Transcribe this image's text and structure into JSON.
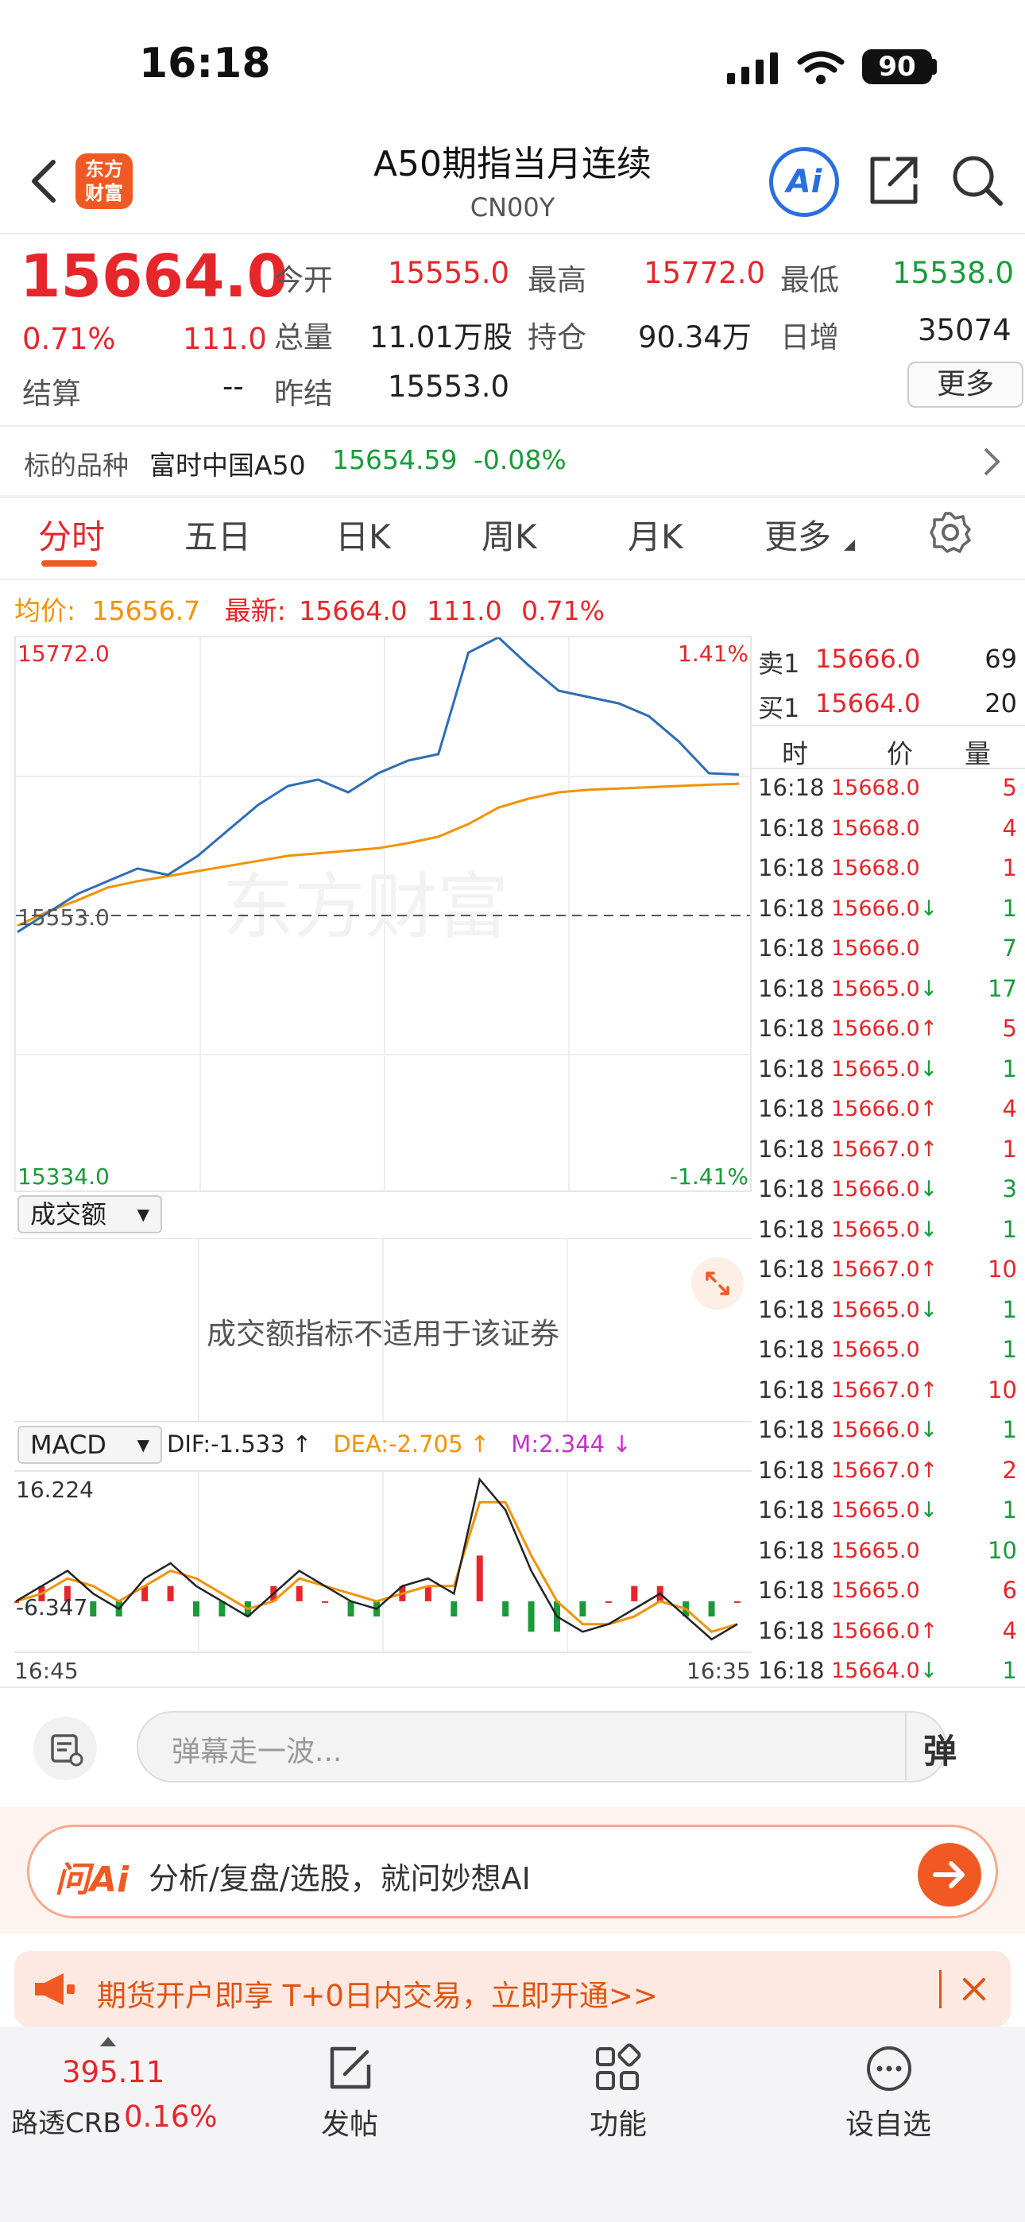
{
  "status_bar": {
    "time": "16:18",
    "battery": "90"
  },
  "nav": {
    "logo_line1": "东方",
    "logo_line2": "财富",
    "title": "A50期指当月连续",
    "code": "CN00Y",
    "ai_label": "Ai"
  },
  "quote": {
    "price": "15664.0",
    "change_pct": "0.71%",
    "change": "111.0",
    "settle_label": "结算",
    "settle": "--",
    "open_label": "今开",
    "open": "15555.0",
    "high_label": "最高",
    "high": "15772.0",
    "low_label": "最低",
    "low": "15538.0",
    "volume_label": "总量",
    "volume": "11.01万股",
    "oi_label": "持仓",
    "oi": "90.34万",
    "daily_inc_label": "日增",
    "daily_inc": "35074",
    "prev_settle_label": "昨结",
    "prev_settle": "15553.0",
    "more_label": "更多"
  },
  "underlying": {
    "label": "标的品种",
    "name": "富时中国A50",
    "price": "15654.59",
    "change": "-0.08%"
  },
  "tabs": [
    "分时",
    "五日",
    "日K",
    "周K",
    "月K",
    "更多"
  ],
  "chart_header": {
    "avg_label": "均价:",
    "avg_value": "15656.7",
    "latest_label": "最新:",
    "latest_value": "15664.0",
    "latest_change": "111.0",
    "latest_pct": "0.71%"
  },
  "chart_data": {
    "type": "line",
    "price_axis": {
      "top": "15772.0",
      "mid": "15553.0",
      "bottom": "15334.0",
      "top_pct": "1.41%",
      "bottom_pct": "-1.41%"
    },
    "ylim": [
      15334.0,
      15772.0
    ],
    "series": [
      {
        "name": "最新",
        "values": [
          15540,
          15555,
          15570,
          15580,
          15590,
          15585,
          15600,
          15620,
          15640,
          15655,
          15660,
          15650,
          15665,
          15675,
          15680,
          15760,
          15772,
          15750,
          15730,
          15725,
          15720,
          15710,
          15690,
          15665,
          15664
        ]
      },
      {
        "name": "均价",
        "values": [
          15545,
          15556,
          15565,
          15575,
          15580,
          15584,
          15588,
          15592,
          15596,
          15600,
          15602,
          15604,
          15606,
          15610,
          15615,
          15625,
          15638,
          15645,
          15650,
          15652,
          15653,
          15654,
          15655,
          15656,
          15656.7
        ]
      }
    ]
  },
  "volume_panel": {
    "selector": "成交额",
    "notice": "成交额指标不适用于该证券"
  },
  "macd_panel": {
    "selector": "MACD",
    "dif": "DIF:-1.533 ↑",
    "dea": "DEA:-2.705 ↑",
    "m": "M:2.344 ↓",
    "top": "16.224",
    "bottom": "-6.347",
    "time_start": "16:45",
    "time_end": "16:35",
    "dif_values": [
      0,
      2,
      4,
      1,
      -1,
      3,
      5,
      2,
      0,
      -2,
      1,
      4,
      2,
      0,
      -1,
      2,
      3,
      1,
      16,
      12,
      4,
      -2,
      -4,
      -3,
      -1,
      1,
      -2,
      -5,
      -3
    ],
    "dea_values": [
      0,
      1,
      3,
      2,
      0,
      2,
      4,
      3,
      1,
      -1,
      0,
      3,
      2,
      1,
      0,
      1,
      2,
      2,
      13,
      13,
      6,
      0,
      -3,
      -3,
      -2,
      0,
      -1,
      -4,
      -3
    ]
  },
  "order_book": {
    "ask_label": "卖1",
    "ask_price": "15666.0",
    "ask_vol": "69",
    "bid_label": "买1",
    "bid_price": "15664.0",
    "bid_vol": "20",
    "col_time": "时",
    "col_price": "价",
    "col_vol": "量"
  },
  "trades": [
    {
      "t": "16:18",
      "p": "15668.0",
      "v": "5",
      "dir": "",
      "c": "red"
    },
    {
      "t": "16:18",
      "p": "15668.0",
      "v": "4",
      "dir": "",
      "c": "red"
    },
    {
      "t": "16:18",
      "p": "15668.0",
      "v": "1",
      "dir": "",
      "c": "red"
    },
    {
      "t": "16:18",
      "p": "15666.0",
      "v": "1",
      "dir": "↓",
      "c": "green"
    },
    {
      "t": "16:18",
      "p": "15666.0",
      "v": "7",
      "dir": "",
      "c": "green"
    },
    {
      "t": "16:18",
      "p": "15665.0",
      "v": "17",
      "dir": "↓",
      "c": "green"
    },
    {
      "t": "16:18",
      "p": "15666.0",
      "v": "5",
      "dir": "↑",
      "c": "red"
    },
    {
      "t": "16:18",
      "p": "15665.0",
      "v": "1",
      "dir": "↓",
      "c": "green"
    },
    {
      "t": "16:18",
      "p": "15666.0",
      "v": "4",
      "dir": "↑",
      "c": "red"
    },
    {
      "t": "16:18",
      "p": "15667.0",
      "v": "1",
      "dir": "↑",
      "c": "red"
    },
    {
      "t": "16:18",
      "p": "15666.0",
      "v": "3",
      "dir": "↓",
      "c": "green"
    },
    {
      "t": "16:18",
      "p": "15665.0",
      "v": "1",
      "dir": "↓",
      "c": "green"
    },
    {
      "t": "16:18",
      "p": "15667.0",
      "v": "10",
      "dir": "↑",
      "c": "red"
    },
    {
      "t": "16:18",
      "p": "15665.0",
      "v": "1",
      "dir": "↓",
      "c": "green"
    },
    {
      "t": "16:18",
      "p": "15665.0",
      "v": "1",
      "dir": "",
      "c": "green"
    },
    {
      "t": "16:18",
      "p": "15667.0",
      "v": "10",
      "dir": "↑",
      "c": "red"
    },
    {
      "t": "16:18",
      "p": "15666.0",
      "v": "1",
      "dir": "↓",
      "c": "green"
    },
    {
      "t": "16:18",
      "p": "15667.0",
      "v": "2",
      "dir": "↑",
      "c": "red"
    },
    {
      "t": "16:18",
      "p": "15665.0",
      "v": "1",
      "dir": "↓",
      "c": "green"
    },
    {
      "t": "16:18",
      "p": "15665.0",
      "v": "10",
      "dir": "",
      "c": "green"
    },
    {
      "t": "16:18",
      "p": "15665.0",
      "v": "6",
      "dir": "",
      "c": "red"
    },
    {
      "t": "16:18",
      "p": "15666.0",
      "v": "4",
      "dir": "↑",
      "c": "red"
    },
    {
      "t": "16:18",
      "p": "15664.0",
      "v": "1",
      "dir": "↓",
      "c": "green"
    }
  ],
  "danmu": {
    "placeholder": "弹幕走一波...",
    "toggle": "弹"
  },
  "ask_ai": {
    "brand": "问Ai",
    "text": "分析/复盘/选股，就问妙想AI"
  },
  "notice": {
    "text": "期货开户即享 T+0日内交易，立即开通>>"
  },
  "bottom_bar": {
    "crb_value": "395.11",
    "crb_label": "路透CRB",
    "crb_change": "0.16%",
    "post": "发帖",
    "func": "功能",
    "watch": "设自选"
  },
  "colors": {
    "up": "#e5262b",
    "down": "#1a9a3a",
    "price_line": "#2f6db5",
    "avg_line": "#f39200",
    "brand": "#f05a22"
  }
}
